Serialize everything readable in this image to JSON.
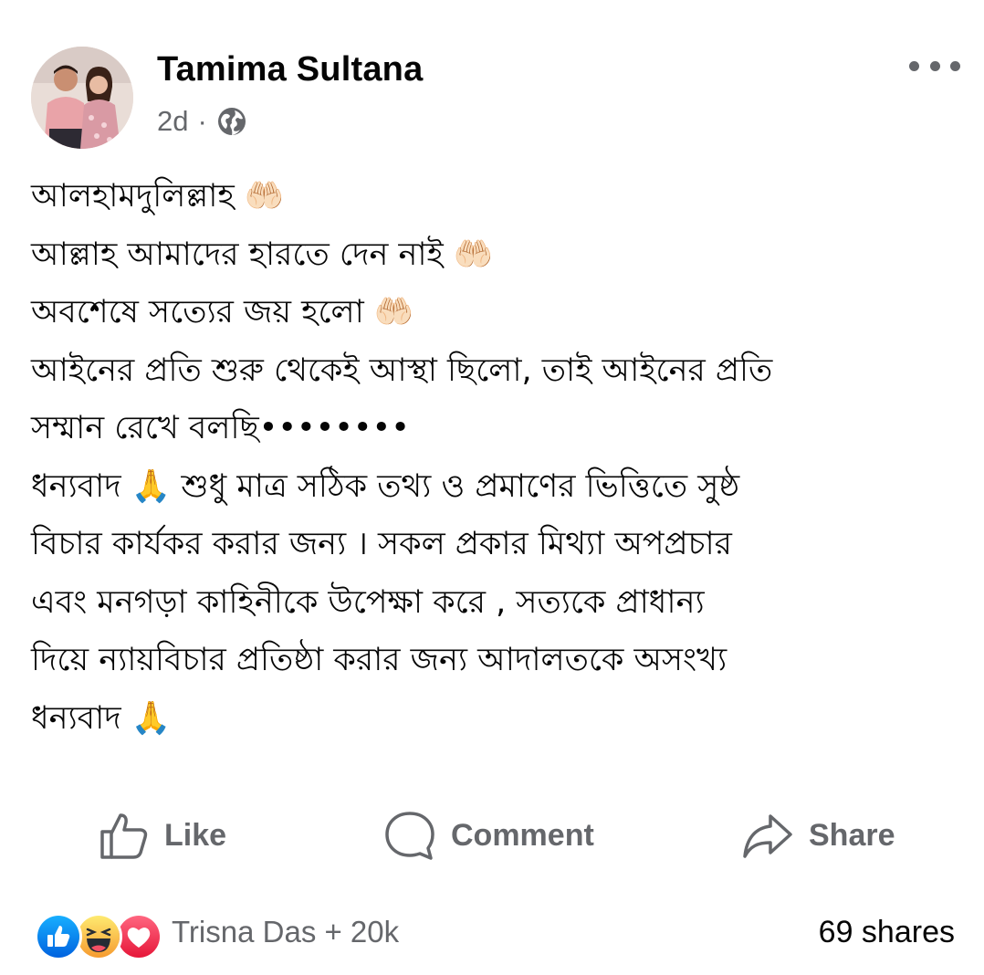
{
  "post": {
    "author": "Tamima Sultana",
    "time": "2d",
    "separator": "·",
    "audience_icon": "globe-icon",
    "lines": [
      "আলহামদুলিল্লাহ 🤲🏻",
      "আল্লাহ আমাদের হারতে দেন নাই 🤲🏻",
      "অবশেষে সত্যের জয় হলো 🤲🏻",
      "আইনের প্রতি শুরু থেকেই আস্থা ছিলো, তাই আইনের প্রতি",
      "সম্মান রেখে বলছি••••••••",
      "ধন্যবাদ 🙏 শুধু মাত্র সঠিক তথ্য ও প্রমাণের ভিত্তিতে সুষ্ঠ",
      "বিচার কার্যকর করার জন্য । সকল প্রকার মিথ্যা অপপ্রচার",
      "এবং মনগড়া কাহিনীকে উপেক্ষা করে , সত্যকে প্রাধান্য",
      "দিয়ে ন্যায়বিচার প্রতিষ্ঠা করার জন্য আদালতকে অসংখ্য",
      "ধন্যবাদ 🙏"
    ]
  },
  "actions": {
    "like": "Like",
    "comment": "Comment",
    "share": "Share"
  },
  "footer": {
    "reactors": "Trisna Das + 20k",
    "shares": "69 shares"
  },
  "colors": {
    "like_blue": "#1877f2",
    "love_red": "#f33e58",
    "haha_yellow": "#f7b125",
    "muted": "#65676b",
    "text": "#050505"
  }
}
